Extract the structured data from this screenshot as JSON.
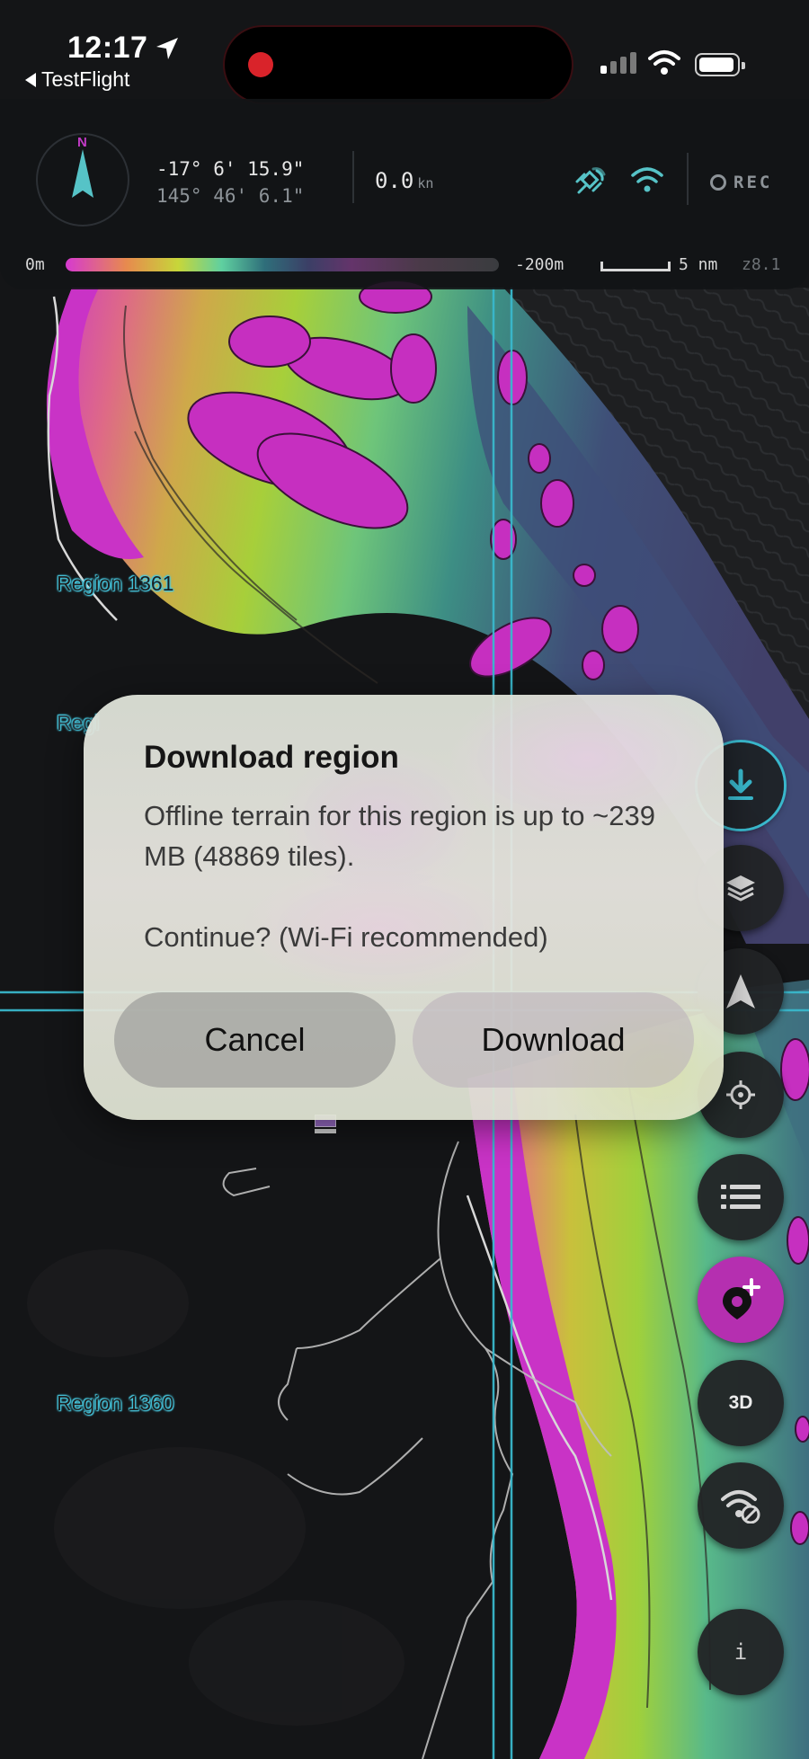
{
  "status_bar": {
    "time": "12:17",
    "back_app": "TestFlight",
    "icons": [
      "location-arrow-icon",
      "signal-icon",
      "wifi-icon",
      "battery-icon"
    ],
    "recording_indicator_color": "#d9232a"
  },
  "hud": {
    "compass_label": "N",
    "latitude": "-17° 6' 15.9\"",
    "longitude": "145° 46' 6.1\"",
    "speed_value": "0.0",
    "speed_unit": "kn",
    "rec_label": "REC",
    "depth_min": "0m",
    "depth_max": "-200m",
    "scale_label": "5 nm",
    "zoom_label": "z8.1",
    "icons": [
      "compass-icon",
      "gps-satellite-icon",
      "wifi-icon",
      "record-icon"
    ]
  },
  "map": {
    "region_labels": [
      "Region 1361",
      "Regi",
      "Region 1360"
    ],
    "accent_color": "#39b8cc"
  },
  "rail": {
    "buttons": [
      {
        "name": "download-region-button",
        "icon": "download-icon"
      },
      {
        "name": "layers-button",
        "icon": "layers-icon"
      },
      {
        "name": "navigation-button",
        "icon": "navigation-arrow-icon"
      },
      {
        "name": "locate-button",
        "icon": "crosshair-icon"
      },
      {
        "name": "list-button",
        "icon": "list-icon"
      },
      {
        "name": "add-pin-button",
        "icon": "add-pin-icon"
      },
      {
        "name": "3d-button",
        "label": "3D"
      },
      {
        "name": "offline-button",
        "icon": "wifi-off-icon"
      },
      {
        "name": "info-button",
        "label": "i"
      }
    ],
    "pin_color": "#b52fb0"
  },
  "dialog": {
    "title": "Download region",
    "body_line1": "Offline terrain for this region is up to ~239 MB (48869 tiles).",
    "body_line2": "Continue? (Wi-Fi recommended)",
    "cancel_label": "Cancel",
    "confirm_label": "Download"
  }
}
